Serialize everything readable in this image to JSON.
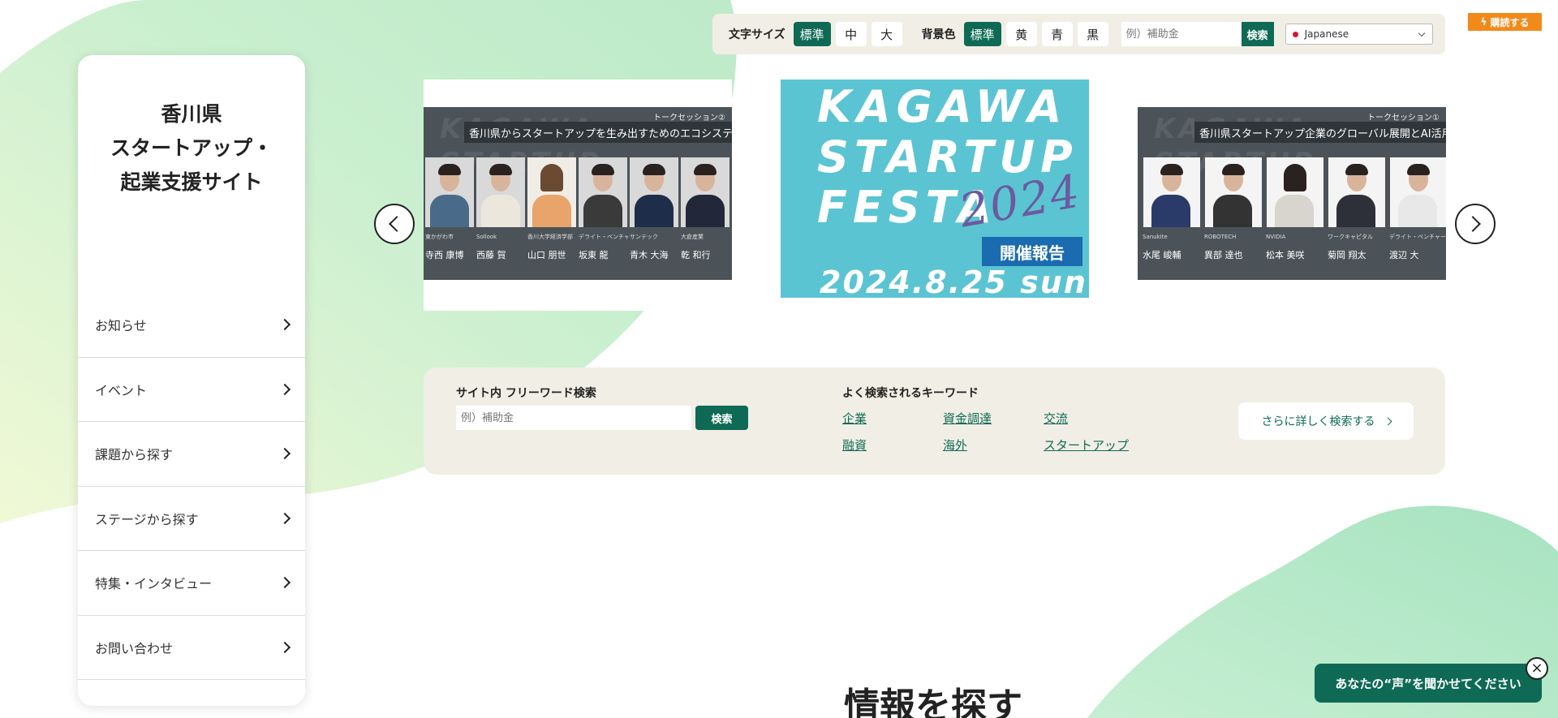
{
  "site": {
    "title_lines": [
      "香川県",
      "スタートアップ・",
      "起業支援サイト"
    ]
  },
  "sidebar": {
    "items": [
      {
        "label": "お知らせ"
      },
      {
        "label": "イベント"
      },
      {
        "label": "課題から探す"
      },
      {
        "label": "ステージから探す"
      },
      {
        "label": "特集・インタビュー"
      },
      {
        "label": "お問い合わせ"
      }
    ]
  },
  "toolbar": {
    "font_size_label": "文字サイズ",
    "font_sizes": [
      "標準",
      "中",
      "大"
    ],
    "bg_color_label": "背景色",
    "bg_colors": [
      "標準",
      "黄",
      "青",
      "黒"
    ],
    "search_placeholder": "例）補助金",
    "search_button": "検索",
    "language": "Japanese"
  },
  "subscribe": {
    "label": "購読する"
  },
  "carousel": {
    "slide1": {
      "session": "トークセッション②",
      "title": "香川県からスタートアップを生み出すためのエコシステム作り",
      "persons": [
        {
          "org": "東かがわ市",
          "name": "寺西 康博"
        },
        {
          "org": "Sollook",
          "name": "西藤 賀"
        },
        {
          "org": "香川大学経済学部",
          "name": "山口 朋世"
        },
        {
          "org": "デライト・ベンチャーズ",
          "name": "坂東 龍"
        },
        {
          "org": "サンテック",
          "name": "青木 大海"
        },
        {
          "org": "大倉産業",
          "name": "乾 和行"
        }
      ]
    },
    "slide2": {
      "lines": [
        "KAGAWA",
        "STARTUP",
        "FESTA"
      ],
      "year": "2024",
      "report": "開催報告",
      "date": "2024.8.25 sun."
    },
    "slide3": {
      "session": "トークセッション①",
      "title": "香川県スタートアップ企業のグローバル展開とAI活用",
      "persons": [
        {
          "org": "Sanukite",
          "name": "水尾 峻輔"
        },
        {
          "org": "ROBOTECH",
          "name": "異部 達也"
        },
        {
          "org": "NVIDIA",
          "name": "松本 美咲"
        },
        {
          "org": "ワークキャピタル",
          "name": "菊岡 翔太"
        },
        {
          "org": "デライト・ベンチャーズ",
          "name": "渡辺 大"
        }
      ]
    }
  },
  "search": {
    "title": "サイト内 フリーワード検索",
    "placeholder": "例）補助金",
    "button": "検索",
    "keywords_title": "よく検索されるキーワード",
    "keywords": [
      "企業",
      "資金調達",
      "交流",
      "融資",
      "海外",
      "スタートアップ"
    ],
    "more": "さらに詳しく検索する"
  },
  "section": {
    "heading": "情報を探す"
  },
  "feedback": {
    "label": "あなたの“声”を聞かせてください"
  },
  "colors": {
    "accent": "#0f6a55",
    "subscribe": "#f28a1a",
    "panel": "#f1eee6",
    "festa": "#5bc4d2"
  }
}
